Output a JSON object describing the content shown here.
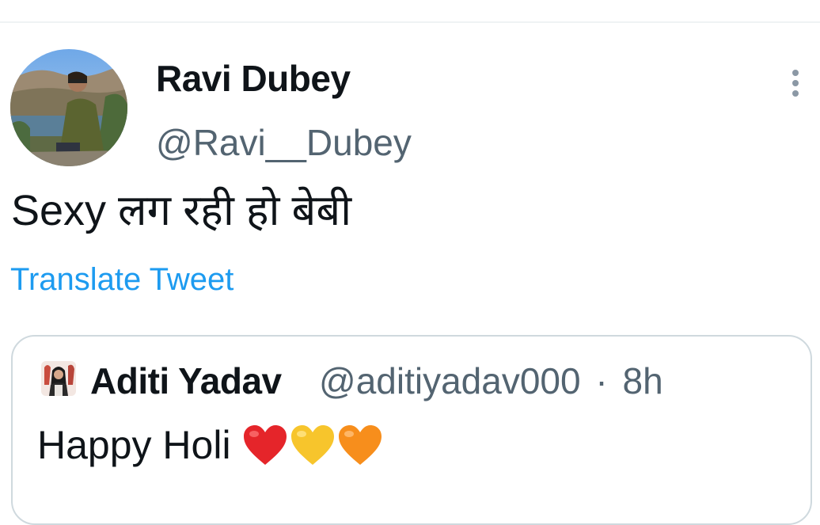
{
  "tweet": {
    "author": {
      "name": "Ravi Dubey",
      "handle": "@Ravi__Dubey"
    },
    "text": "Sexy लग रही हो बेबी",
    "translate_label": "Translate Tweet"
  },
  "quoted_tweet": {
    "author": {
      "name": "Aditi Yadav",
      "handle": "@aditiyadav000"
    },
    "separator": "·",
    "time": "8h",
    "text": "Happy Holi",
    "emojis": [
      "red-heart",
      "yellow-heart",
      "orange-heart"
    ]
  },
  "icons": {
    "more": "more-vertical-icon"
  },
  "colors": {
    "link": "#1d9bf0",
    "secondary_text": "#536471",
    "border": "#cfd9de"
  }
}
